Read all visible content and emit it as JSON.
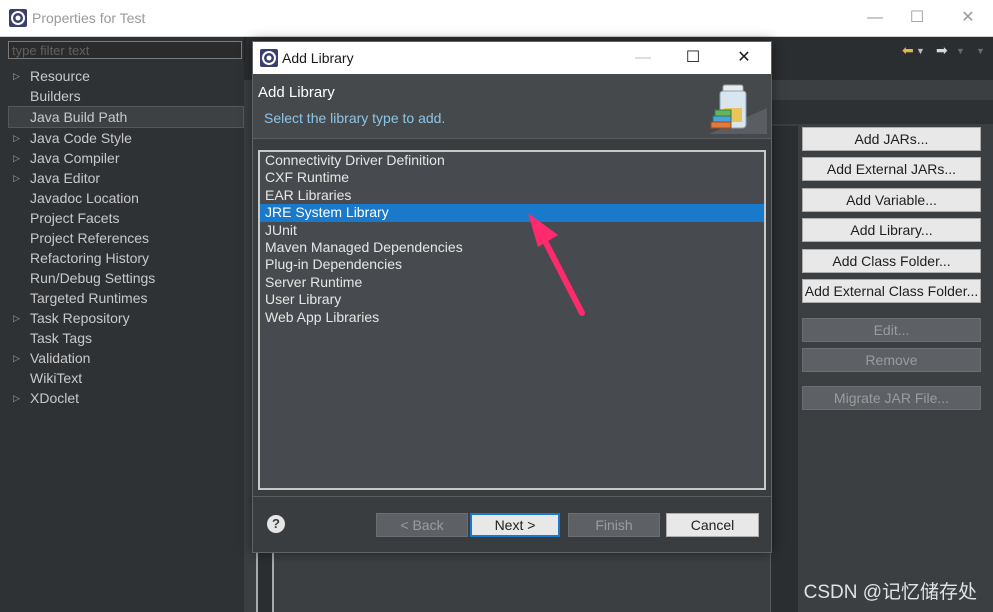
{
  "outer_window": {
    "title": "Properties for Test",
    "controls": {
      "minimize": "—",
      "maximize": "☐",
      "close": "✕"
    }
  },
  "left_panel": {
    "filter_placeholder": "type filter text",
    "items": [
      {
        "label": "Resource",
        "expandable": true
      },
      {
        "label": "Builders",
        "expandable": false
      },
      {
        "label": "Java Build Path",
        "expandable": false,
        "selected": true
      },
      {
        "label": "Java Code Style",
        "expandable": true
      },
      {
        "label": "Java Compiler",
        "expandable": true
      },
      {
        "label": "Java Editor",
        "expandable": true
      },
      {
        "label": "Javadoc Location",
        "expandable": false
      },
      {
        "label": "Project Facets",
        "expandable": false
      },
      {
        "label": "Project References",
        "expandable": false
      },
      {
        "label": "Refactoring History",
        "expandable": false
      },
      {
        "label": "Run/Debug Settings",
        "expandable": false
      },
      {
        "label": "Targeted Runtimes",
        "expandable": false
      },
      {
        "label": "Task Repository",
        "expandable": true
      },
      {
        "label": "Task Tags",
        "expandable": false
      },
      {
        "label": "Validation",
        "expandable": true
      },
      {
        "label": "WikiText",
        "expandable": false
      },
      {
        "label": "XDoclet",
        "expandable": true
      }
    ]
  },
  "right_buttons": {
    "add_jars": "Add JARs...",
    "add_external_jars": "Add External JARs...",
    "add_variable": "Add Variable...",
    "add_library": "Add Library...",
    "add_class_folder": "Add Class Folder...",
    "add_external_class_folder": "Add External Class Folder...",
    "edit": "Edit...",
    "remove": "Remove",
    "migrate_jar": "Migrate JAR File..."
  },
  "dialog": {
    "title": "Add Library",
    "controls": {
      "minimize": "—",
      "maximize": "☐",
      "close": "✕"
    },
    "header_title": "Add Library",
    "header_message": "Select the library type to add.",
    "library_types": [
      "Connectivity Driver Definition",
      "CXF Runtime",
      "EAR Libraries",
      "JRE System Library",
      "JUnit",
      "Maven Managed Dependencies",
      "Plug-in Dependencies",
      "Server Runtime",
      "User Library",
      "Web App Libraries"
    ],
    "selected_index": 3,
    "help_glyph": "?",
    "buttons": {
      "back": "< Back",
      "next": "Next >",
      "finish": "Finish",
      "cancel": "Cancel"
    }
  },
  "watermark": "CSDN @记忆储存处",
  "colors": {
    "selection": "#1979ca",
    "annotation_arrow": "#ff2a6d",
    "header_message": "#8fc4e8"
  }
}
